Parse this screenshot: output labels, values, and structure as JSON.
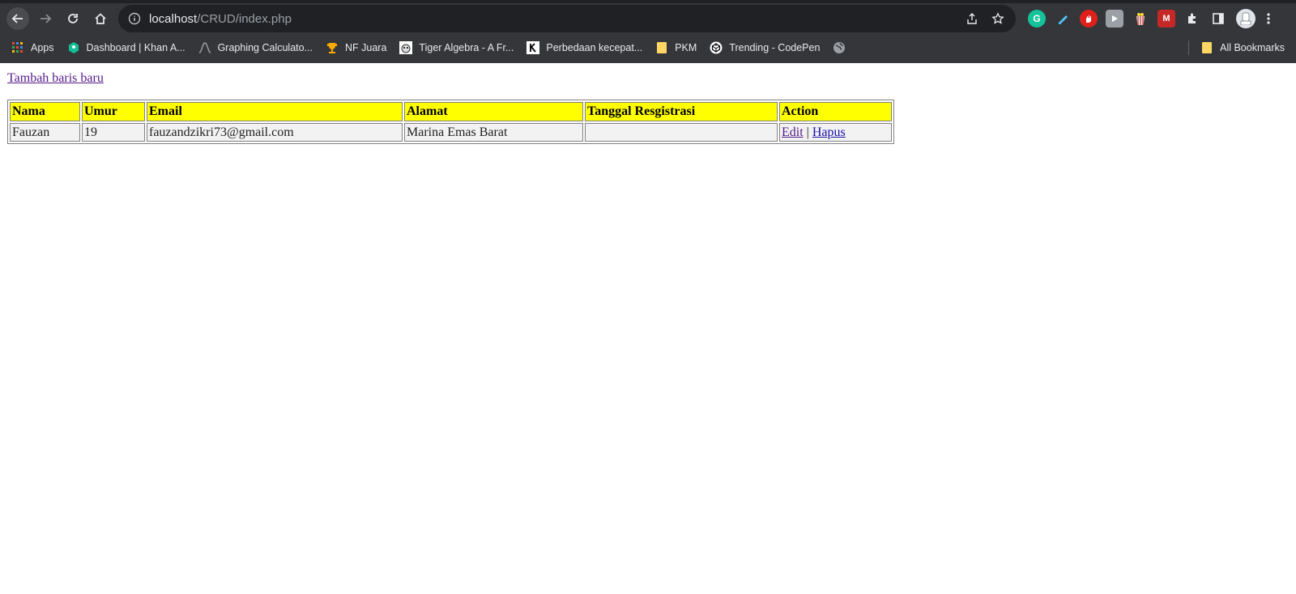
{
  "browser": {
    "url_host": "localhost",
    "url_path": "/CRUD/index.php",
    "bookmarks": [
      {
        "label": "Apps",
        "icon": "apps-grid-icon"
      },
      {
        "label": "Dashboard | Khan A...",
        "icon": "khan-academy-icon"
      },
      {
        "label": "Graphing Calculato...",
        "icon": "desmos-icon"
      },
      {
        "label": "NF Juara",
        "icon": "trophy-icon"
      },
      {
        "label": "Tiger Algebra - A Fr...",
        "icon": "tiger-icon"
      },
      {
        "label": "Perbedaan kecepat...",
        "icon": "k-icon"
      },
      {
        "label": "PKM",
        "icon": "folder-icon"
      },
      {
        "label": "Trending - CodePen",
        "icon": "codepen-icon"
      },
      {
        "label": "",
        "icon": "globe-icon"
      }
    ],
    "all_bookmarks": "All Bookmarks",
    "colors": {
      "chrome": "#35363a",
      "omnibox": "#202124",
      "text": "#e8eaed"
    }
  },
  "page": {
    "add_link": "Tambah baris baru",
    "table": {
      "headers": {
        "nama": "Nama",
        "umur": "Umur",
        "email": "Email",
        "alamat": "Alamat",
        "tanggal": "Tanggal Resgistrasi",
        "action": "Action"
      },
      "rows": [
        {
          "nama": "Fauzan",
          "umur": "19",
          "email": "fauzandzikri73@gmail.com",
          "alamat": "Marina Emas Barat",
          "tanggal": "",
          "edit": "Edit",
          "separator": "|",
          "hapus": "Hapus"
        }
      ]
    },
    "colors": {
      "header_bg": "#ffff00",
      "cell_bg": "#f2f2f2"
    }
  }
}
